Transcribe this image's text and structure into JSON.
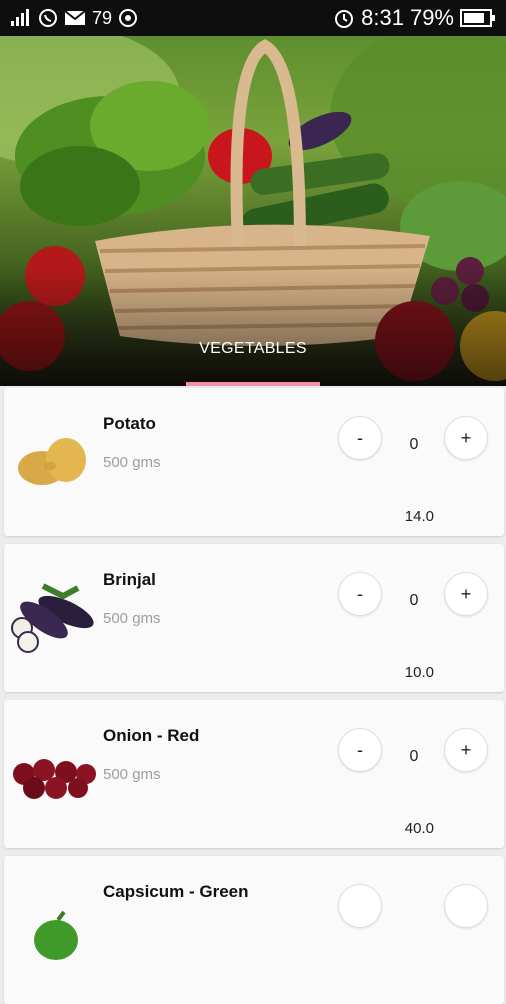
{
  "status_bar": {
    "signal_text": "79",
    "time": "8:31",
    "battery": "79%"
  },
  "hero": {
    "tab_label": "VEGETABLES",
    "indicator_color": "#f48fb1"
  },
  "products": [
    {
      "name": "Potato",
      "quantity": "500 gms",
      "count": "0",
      "price": "14.0",
      "minus": "-",
      "plus": "+",
      "icon": "potato-image"
    },
    {
      "name": "Brinjal",
      "quantity": "500 gms",
      "count": "0",
      "price": "10.0",
      "minus": "-",
      "plus": "+",
      "icon": "brinjal-image"
    },
    {
      "name": "Onion - Red",
      "quantity": "500 gms",
      "count": "0",
      "price": "40.0",
      "minus": "-",
      "plus": "+",
      "icon": "onion-image"
    },
    {
      "name": "Capsicum - Green",
      "quantity": "",
      "count": "",
      "price": "",
      "minus": "",
      "plus": "",
      "icon": "capsicum-image"
    }
  ]
}
